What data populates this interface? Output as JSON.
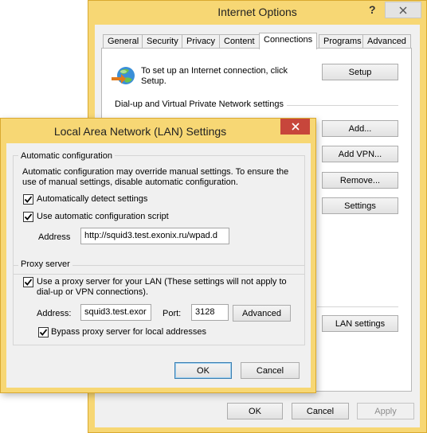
{
  "internet_options": {
    "title": "Internet Options",
    "help_label": "?",
    "tabs": [
      "General",
      "Security",
      "Privacy",
      "Content",
      "Connections",
      "Programs",
      "Advanced"
    ],
    "active_tab": "Connections",
    "setup_text": "To set up an Internet connection, click Setup.",
    "setup_button": "Setup",
    "dialup_heading": "Dial-up and Virtual Private Network settings",
    "add_button": "Add...",
    "add_vpn_button": "Add VPN...",
    "remove_button": "Remove...",
    "settings_button": "Settings",
    "lan_settings_button": "LAN settings",
    "ok_button": "OK",
    "cancel_button": "Cancel",
    "apply_button": "Apply"
  },
  "lan_dialog": {
    "title": "Local Area Network (LAN) Settings",
    "auto_config": {
      "heading": "Automatic configuration",
      "description": "Automatic configuration may override manual settings.  To ensure the use of manual settings, disable automatic configuration.",
      "auto_detect_label": "Automatically detect settings",
      "auto_detect_checked": true,
      "use_script_label": "Use automatic configuration script",
      "use_script_checked": true,
      "address_label": "Address",
      "address_value": "http://squid3.test.exonix.ru/wpad.d"
    },
    "proxy": {
      "heading": "Proxy server",
      "use_proxy_label": "Use a proxy server for your LAN (These settings will not apply to dial-up or VPN connections).",
      "use_proxy_checked": true,
      "address_label": "Address:",
      "address_value": "squid3.test.exor",
      "port_label": "Port:",
      "port_value": "3128",
      "advanced_button": "Advanced",
      "bypass_label": "Bypass proxy server for local addresses",
      "bypass_checked": true
    },
    "ok_button": "OK",
    "cancel_button": "Cancel"
  },
  "colors": {
    "window_frame": "#f7d774",
    "lan_close": "#c7463b",
    "dialog_body": "#f0f0f0"
  },
  "icons": {
    "connection": "globe-network-icon",
    "close": "close-icon",
    "check": "checkmark-icon"
  }
}
